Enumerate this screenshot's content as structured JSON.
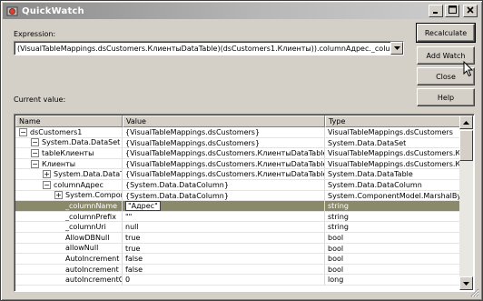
{
  "window": {
    "title": "QuickWatch"
  },
  "expression": {
    "label": "Expression:",
    "value": "(VisualTableMappings.dsCustomers.КлиентыDataTable)(dsCustomers1.Клиенты)).columnАдрес._columnName"
  },
  "buttons": {
    "recalculate": "Recalculate",
    "add_watch": "Add Watch",
    "close": "Close",
    "help": "Help"
  },
  "current_value": {
    "label": "Current value:",
    "columns": [
      "Name",
      "Value",
      "Type"
    ],
    "rows": [
      {
        "depth": 0,
        "expander": "−",
        "name": "dsCustomers1",
        "value": "{VisualTableMappings.dsCustomers}",
        "type": "VisualTableMappings.dsCustomers",
        "selected": false
      },
      {
        "depth": 1,
        "expander": "−",
        "name": "System.Data.DataSet",
        "value": "{VisualTableMappings.dsCustomers}",
        "type": "System.Data.DataSet",
        "selected": false
      },
      {
        "depth": 1,
        "expander": "−",
        "name": "tableКлиенты",
        "value": "{VisualTableMappings.dsCustomers.КлиентыDataTable}",
        "type": "VisualTableMappings.dsCustomers.Кли",
        "selected": false
      },
      {
        "depth": 1,
        "expander": "−",
        "name": "Клиенты",
        "value": "{VisualTableMappings.dsCustomers.КлиентыDataTable}",
        "type": "VisualTableMappings.dsCustomers.Кли",
        "selected": false
      },
      {
        "depth": 2,
        "expander": "+",
        "name": "System.Data.DataTa",
        "value": "{VisualTableMappings.dsCustomers.КлиентыDataTable}",
        "type": "System.Data.DataTable",
        "selected": false
      },
      {
        "depth": 2,
        "expander": "−",
        "name": "columnАдрес",
        "value": "{System.Data.DataColumn}",
        "type": "System.Data.DataColumn",
        "selected": false
      },
      {
        "depth": 3,
        "expander": "+",
        "name": "System.Compone",
        "value": "{System.Data.DataColumn}",
        "type": "System.ComponentModel.MarshalByVa",
        "selected": false
      },
      {
        "depth": 3,
        "expander": "",
        "name": "_columnName",
        "value": "\"Адрес\"",
        "type": "string",
        "selected": true
      },
      {
        "depth": 3,
        "expander": "",
        "name": "_columnPrefix",
        "value": "\"\"",
        "type": "string",
        "selected": false
      },
      {
        "depth": 3,
        "expander": "",
        "name": "_columnUri",
        "value": "null",
        "type": "string",
        "selected": false
      },
      {
        "depth": 3,
        "expander": "",
        "name": "AllowDBNull",
        "value": "true",
        "type": "bool",
        "selected": false
      },
      {
        "depth": 3,
        "expander": "",
        "name": "allowNull",
        "value": "true",
        "type": "bool",
        "selected": false
      },
      {
        "depth": 3,
        "expander": "",
        "name": "AutoIncrement",
        "value": "false",
        "type": "bool",
        "selected": false
      },
      {
        "depth": 3,
        "expander": "",
        "name": "autoIncrement",
        "value": "false",
        "type": "bool",
        "selected": false
      },
      {
        "depth": 3,
        "expander": "",
        "name": "autoIncrementC",
        "value": "0",
        "type": "long",
        "selected": false
      }
    ]
  },
  "icons": {
    "app": "quickwatch-app-icon",
    "minimize": "minimize-icon",
    "maximize": "maximize-icon",
    "close": "close-icon",
    "dropdown": "chevron-down-icon",
    "scroll_up": "arrow-up-icon",
    "scroll_down": "arrow-down-icon",
    "resize_grip": "resize-grip-icon"
  },
  "colors": {
    "selection": "#8a8a6a",
    "face": "#d4d0c8"
  }
}
